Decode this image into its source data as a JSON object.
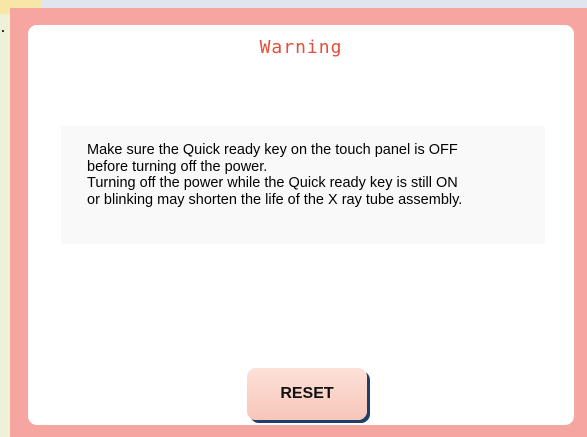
{
  "dialog": {
    "title": "Warning",
    "message_lines": [
      "Make sure the Quick ready key on the touch panel is OFF",
      "before turning off the power.",
      "Turning off the power while the Quick ready key is still ON",
      "or blinking may shorten the life of the X ray tube assembly."
    ],
    "reset_label": "RESET"
  },
  "colors": {
    "frame": "#f5a6a1",
    "title": "#e0503a",
    "button_shadow": "#1f3f6b"
  }
}
